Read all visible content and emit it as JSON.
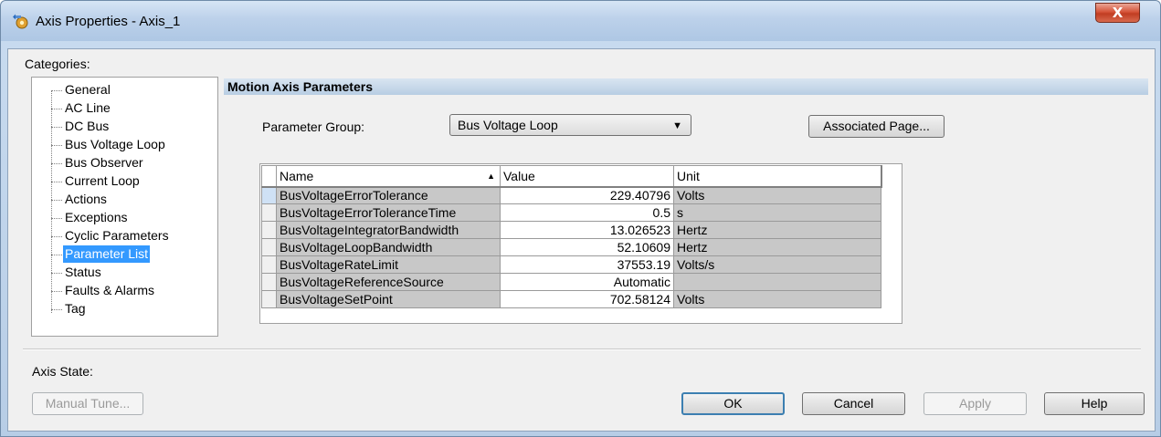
{
  "window": {
    "title": "Axis Properties - Axis_1",
    "close_label": "X"
  },
  "categories": {
    "label": "Categories:",
    "items": [
      {
        "label": "General",
        "selected": false
      },
      {
        "label": "AC Line",
        "selected": false
      },
      {
        "label": "DC Bus",
        "selected": false
      },
      {
        "label": "Bus Voltage Loop",
        "selected": false
      },
      {
        "label": "Bus Observer",
        "selected": false
      },
      {
        "label": "Current Loop",
        "selected": false
      },
      {
        "label": "Actions",
        "selected": false
      },
      {
        "label": "Exceptions",
        "selected": false
      },
      {
        "label": "Cyclic Parameters",
        "selected": false
      },
      {
        "label": "Parameter List",
        "selected": true
      },
      {
        "label": "Status",
        "selected": false
      },
      {
        "label": "Faults & Alarms",
        "selected": false
      },
      {
        "label": "Tag",
        "selected": false
      }
    ]
  },
  "section": {
    "title": "Motion Axis Parameters"
  },
  "parameter_group": {
    "label": "Parameter Group:",
    "value": "Bus Voltage Loop",
    "associated_page_label": "Associated Page..."
  },
  "table": {
    "headers": {
      "name": "Name",
      "value": "Value",
      "unit": "Unit"
    },
    "sort_indicator": "▲",
    "rows": [
      {
        "name": "BusVoltageErrorTolerance",
        "value": "229.40796",
        "unit": "Volts"
      },
      {
        "name": "BusVoltageErrorToleranceTime",
        "value": "0.5",
        "unit": "s"
      },
      {
        "name": "BusVoltageIntegratorBandwidth",
        "value": "13.026523",
        "unit": "Hertz"
      },
      {
        "name": "BusVoltageLoopBandwidth",
        "value": "52.10609",
        "unit": "Hertz"
      },
      {
        "name": "BusVoltageRateLimit",
        "value": "37553.19",
        "unit": "Volts/s"
      },
      {
        "name": "BusVoltageReferenceSource",
        "value": "Automatic",
        "unit": ""
      },
      {
        "name": "BusVoltageSetPoint",
        "value": "702.58124",
        "unit": "Volts"
      }
    ]
  },
  "footer": {
    "axis_state_label": "Axis State:",
    "manual_tune_label": "Manual Tune...",
    "ok_label": "OK",
    "cancel_label": "Cancel",
    "apply_label": "Apply",
    "help_label": "Help"
  },
  "colors": {
    "selection": "#3399ff",
    "section_bar": "#b8cde3",
    "readonly_cell": "#c8c8c8"
  }
}
